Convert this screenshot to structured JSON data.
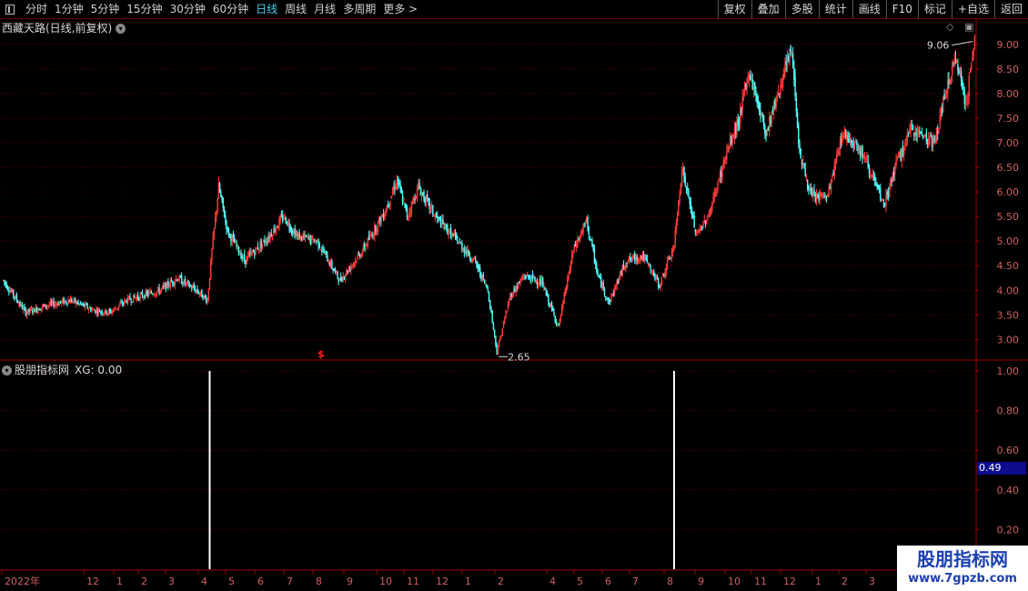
{
  "toolbar": {
    "tabs": [
      "分时",
      "1分钟",
      "5分钟",
      "15分钟",
      "30分钟",
      "60分钟",
      "日线",
      "周线",
      "月线",
      "多周期",
      "更多 >"
    ],
    "active": "日线",
    "right_buttons": [
      "复权",
      "叠加",
      "多股",
      "统计",
      "画线",
      "F10",
      "标记",
      "+自选",
      "返回"
    ]
  },
  "main": {
    "title": "西藏天路(日线,前复权)",
    "high_label": "9.06",
    "low_label": "2.65",
    "y_ticks": [
      "9.00",
      "8.50",
      "8.00",
      "7.50",
      "7.00",
      "6.50",
      "6.00",
      "5.50",
      "5.00",
      "4.50",
      "4.00",
      "3.50",
      "3.00"
    ],
    "marker": "$"
  },
  "indicator": {
    "name": "股朋指标网",
    "xg_text": "XG: 0.00",
    "y_ticks": [
      "1.00",
      "0.80",
      "0.60",
      "0.40",
      "0.20"
    ],
    "current_value": "0.49"
  },
  "x_axis": [
    "2022年",
    "12",
    "1",
    "2",
    "3",
    "4",
    "5",
    "6",
    "7",
    "8",
    "9",
    "10",
    "11",
    "12",
    "1",
    "2",
    "4",
    "5",
    "6",
    "7",
    "8",
    "9",
    "10",
    "11",
    "12",
    "1",
    "2",
    "3"
  ],
  "watermark": {
    "line1": "股朋指标网",
    "line2": "www.7gpzb.com"
  },
  "colors": {
    "up": "#ff3b3b",
    "down": "#54ffff",
    "grid": "#7a0000",
    "signal": "#ffffff"
  },
  "chart_data": {
    "type": "candlestick",
    "ylim": [
      2.6,
      9.2
    ],
    "anchors": [
      [
        0,
        4.2
      ],
      [
        20,
        3.55
      ],
      [
        40,
        3.7
      ],
      [
        60,
        3.8
      ],
      [
        80,
        3.6
      ],
      [
        95,
        3.55
      ],
      [
        110,
        3.8
      ],
      [
        125,
        3.9
      ],
      [
        140,
        4.0
      ],
      [
        155,
        4.25
      ],
      [
        172,
        4.0
      ],
      [
        182,
        3.8
      ],
      [
        186,
        4.8
      ],
      [
        192,
        6.1
      ],
      [
        200,
        5.2
      ],
      [
        215,
        4.6
      ],
      [
        235,
        5.05
      ],
      [
        250,
        5.5
      ],
      [
        262,
        5.1
      ],
      [
        280,
        5.0
      ],
      [
        300,
        4.2
      ],
      [
        320,
        4.8
      ],
      [
        340,
        5.6
      ],
      [
        351,
        6.25
      ],
      [
        360,
        5.5
      ],
      [
        370,
        6.1
      ],
      [
        385,
        5.5
      ],
      [
        405,
        5.0
      ],
      [
        420,
        4.6
      ],
      [
        432,
        4.0
      ],
      [
        440,
        2.75
      ],
      [
        452,
        3.9
      ],
      [
        465,
        4.3
      ],
      [
        480,
        4.15
      ],
      [
        495,
        3.25
      ],
      [
        508,
        4.8
      ],
      [
        520,
        5.4
      ],
      [
        530,
        4.3
      ],
      [
        540,
        3.75
      ],
      [
        555,
        4.6
      ],
      [
        570,
        4.7
      ],
      [
        585,
        4.1
      ],
      [
        598,
        4.9
      ],
      [
        605,
        6.5
      ],
      [
        618,
        5.1
      ],
      [
        630,
        5.6
      ],
      [
        645,
        6.8
      ],
      [
        655,
        7.4
      ],
      [
        665,
        8.45
      ],
      [
        680,
        7.2
      ],
      [
        693,
        8.2
      ],
      [
        703,
        8.9
      ],
      [
        710,
        6.8
      ],
      [
        720,
        5.9
      ],
      [
        735,
        5.9
      ],
      [
        748,
        7.2
      ],
      [
        760,
        7.0
      ],
      [
        770,
        6.6
      ],
      [
        785,
        5.7
      ],
      [
        795,
        6.5
      ],
      [
        810,
        7.3
      ],
      [
        830,
        7.0
      ],
      [
        842,
        8.2
      ],
      [
        850,
        8.7
      ],
      [
        858,
        7.8
      ],
      [
        866,
        9.06
      ]
    ],
    "signal_x": [
      184,
      598
    ]
  }
}
